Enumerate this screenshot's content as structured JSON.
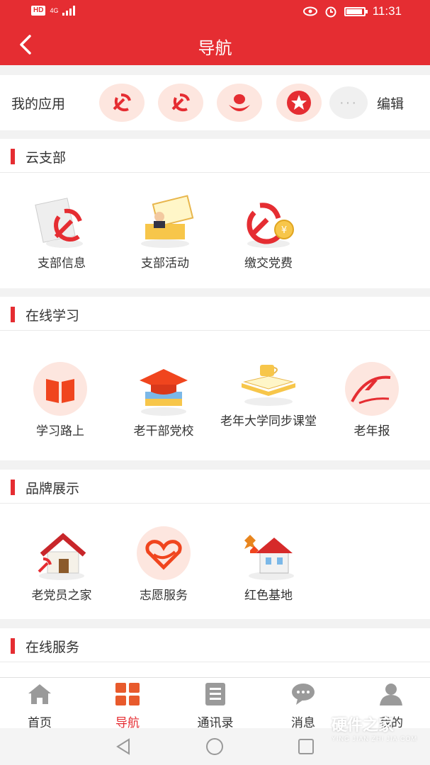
{
  "status_bar": {
    "network": "HD",
    "signal_label": "4G",
    "time": "11:31",
    "battery_level": 0.9
  },
  "header": {
    "title": "导航"
  },
  "my_apps": {
    "label": "我的应用",
    "apps": [
      {
        "icon": "party-emblem-icon"
      },
      {
        "icon": "party-emblem-icon"
      },
      {
        "icon": "people-icon"
      },
      {
        "icon": "star-icon"
      }
    ],
    "more": "···",
    "edit": "编辑"
  },
  "sections": {
    "yunzhibu": {
      "title": "云支部",
      "items": [
        {
          "label": "支部信息",
          "icon": "branch-info-icon"
        },
        {
          "label": "支部活动",
          "icon": "branch-activity-icon"
        },
        {
          "label": "缴交党费",
          "icon": "party-fee-icon"
        }
      ]
    },
    "online_study": {
      "title": "在线学习",
      "items": [
        {
          "label": "学习路上",
          "icon": "book-icon"
        },
        {
          "label": "老干部党校",
          "icon": "graduation-cap-icon"
        },
        {
          "label": "老年大学同步课堂",
          "icon": "coffee-book-icon"
        },
        {
          "label": "老年报",
          "icon": "newspaper-logo-icon"
        }
      ]
    },
    "brand": {
      "title": "品牌展示",
      "items": [
        {
          "label": "老党员之家",
          "icon": "house-icon"
        },
        {
          "label": "志愿服务",
          "icon": "heart-hand-icon"
        },
        {
          "label": "红色基地",
          "icon": "red-base-icon"
        }
      ]
    },
    "online_service": {
      "title": "在线服务"
    }
  },
  "bottom_nav": {
    "items": [
      {
        "label": "首页",
        "icon": "home-icon"
      },
      {
        "label": "导航",
        "icon": "grid-icon"
      },
      {
        "label": "通讯录",
        "icon": "contacts-icon"
      },
      {
        "label": "消息",
        "icon": "message-icon"
      },
      {
        "label": "我的",
        "icon": "user-icon"
      }
    ],
    "active": "导航"
  },
  "watermark": {
    "title": "硬件之家",
    "sub": "YING JIAN ZHI JIA.COM"
  },
  "colors": {
    "brand": "#e52d32",
    "bg": "#f2f2f2",
    "icon_bg": "#fde6df"
  }
}
